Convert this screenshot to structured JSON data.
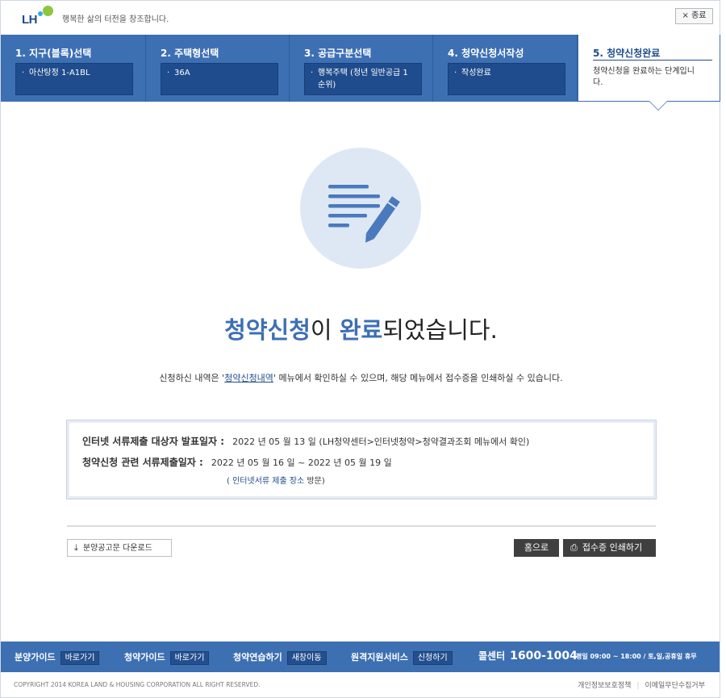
{
  "header": {
    "logo_text": "LH",
    "slogan": "행복한 삶의 터전을 창조합니다.",
    "close_label": "× 종료"
  },
  "steps": [
    {
      "title": "1. 지구(블록)선택",
      "value": "아산탕정 1-A1BL"
    },
    {
      "title": "2. 주택형선택",
      "value": "36A"
    },
    {
      "title": "3. 공급구분선택",
      "value": "행복주택 (청년 일반공급 1순위)"
    },
    {
      "title": "4. 청약신청서작성",
      "value": "작성완료"
    },
    {
      "title": "5. 청약신청완료",
      "value": "청약신청을 완료하는 단계입니다."
    }
  ],
  "main": {
    "headline_part1": "청약신청",
    "headline_part2": "이 ",
    "headline_part3": "완료",
    "headline_part4": "되었습니다.",
    "desc_prefix": "신청하신 내역은 '",
    "desc_link": "청약신청내역",
    "desc_suffix": "' 메뉴에서 확인하실 수 있으며, 해당 메뉴에서 접수증을 인쇄하실 수 있습니다."
  },
  "info": {
    "row1_label": "인터넷 서류제출 대상자 발표일자 :",
    "row1_value": "2022 년 05 월 13 일 (LH청약센터>인터넷청약>청약결과조회 메뉴에서 확인)",
    "row2_label": "청약신청 관련 서류제출일자 :",
    "row2_value": "2022 년 05 월 16 일 ~ 2022 년 05 월 19 일",
    "link_open": "( ",
    "link_text": "인터넷서류 제출 장소",
    "link_close": " 방문)"
  },
  "actions": {
    "download_label": "분양공고문 다운로드",
    "home_label": "홈으로",
    "print_label": "접수증 인쇄하기"
  },
  "footer": {
    "items": [
      {
        "label": "분양가이드",
        "button": "바로가기"
      },
      {
        "label": "청약가이드",
        "button": "바로가기"
      },
      {
        "label": "청약연습하기",
        "button": "새창이동"
      },
      {
        "label": "원격지원서비스",
        "button": "신청하기"
      }
    ],
    "callcenter_label": "콜센터",
    "callcenter_number": "1600-1004",
    "hours": "평일 09:00 ~ 18:00 / 토,일,공휴일 휴무",
    "copyright": "COPYRIGHT 2014 KOREA LAND & HOUSING CORPORATION ALL RIGHT RESERVED.",
    "privacy_link": "개인정보보호정책",
    "email_link": "이메일무단수집거부"
  },
  "colors": {
    "primary": "#3d6fb3",
    "dark_box": "#1f4c8c",
    "button_dark": "#3f3f3f"
  }
}
